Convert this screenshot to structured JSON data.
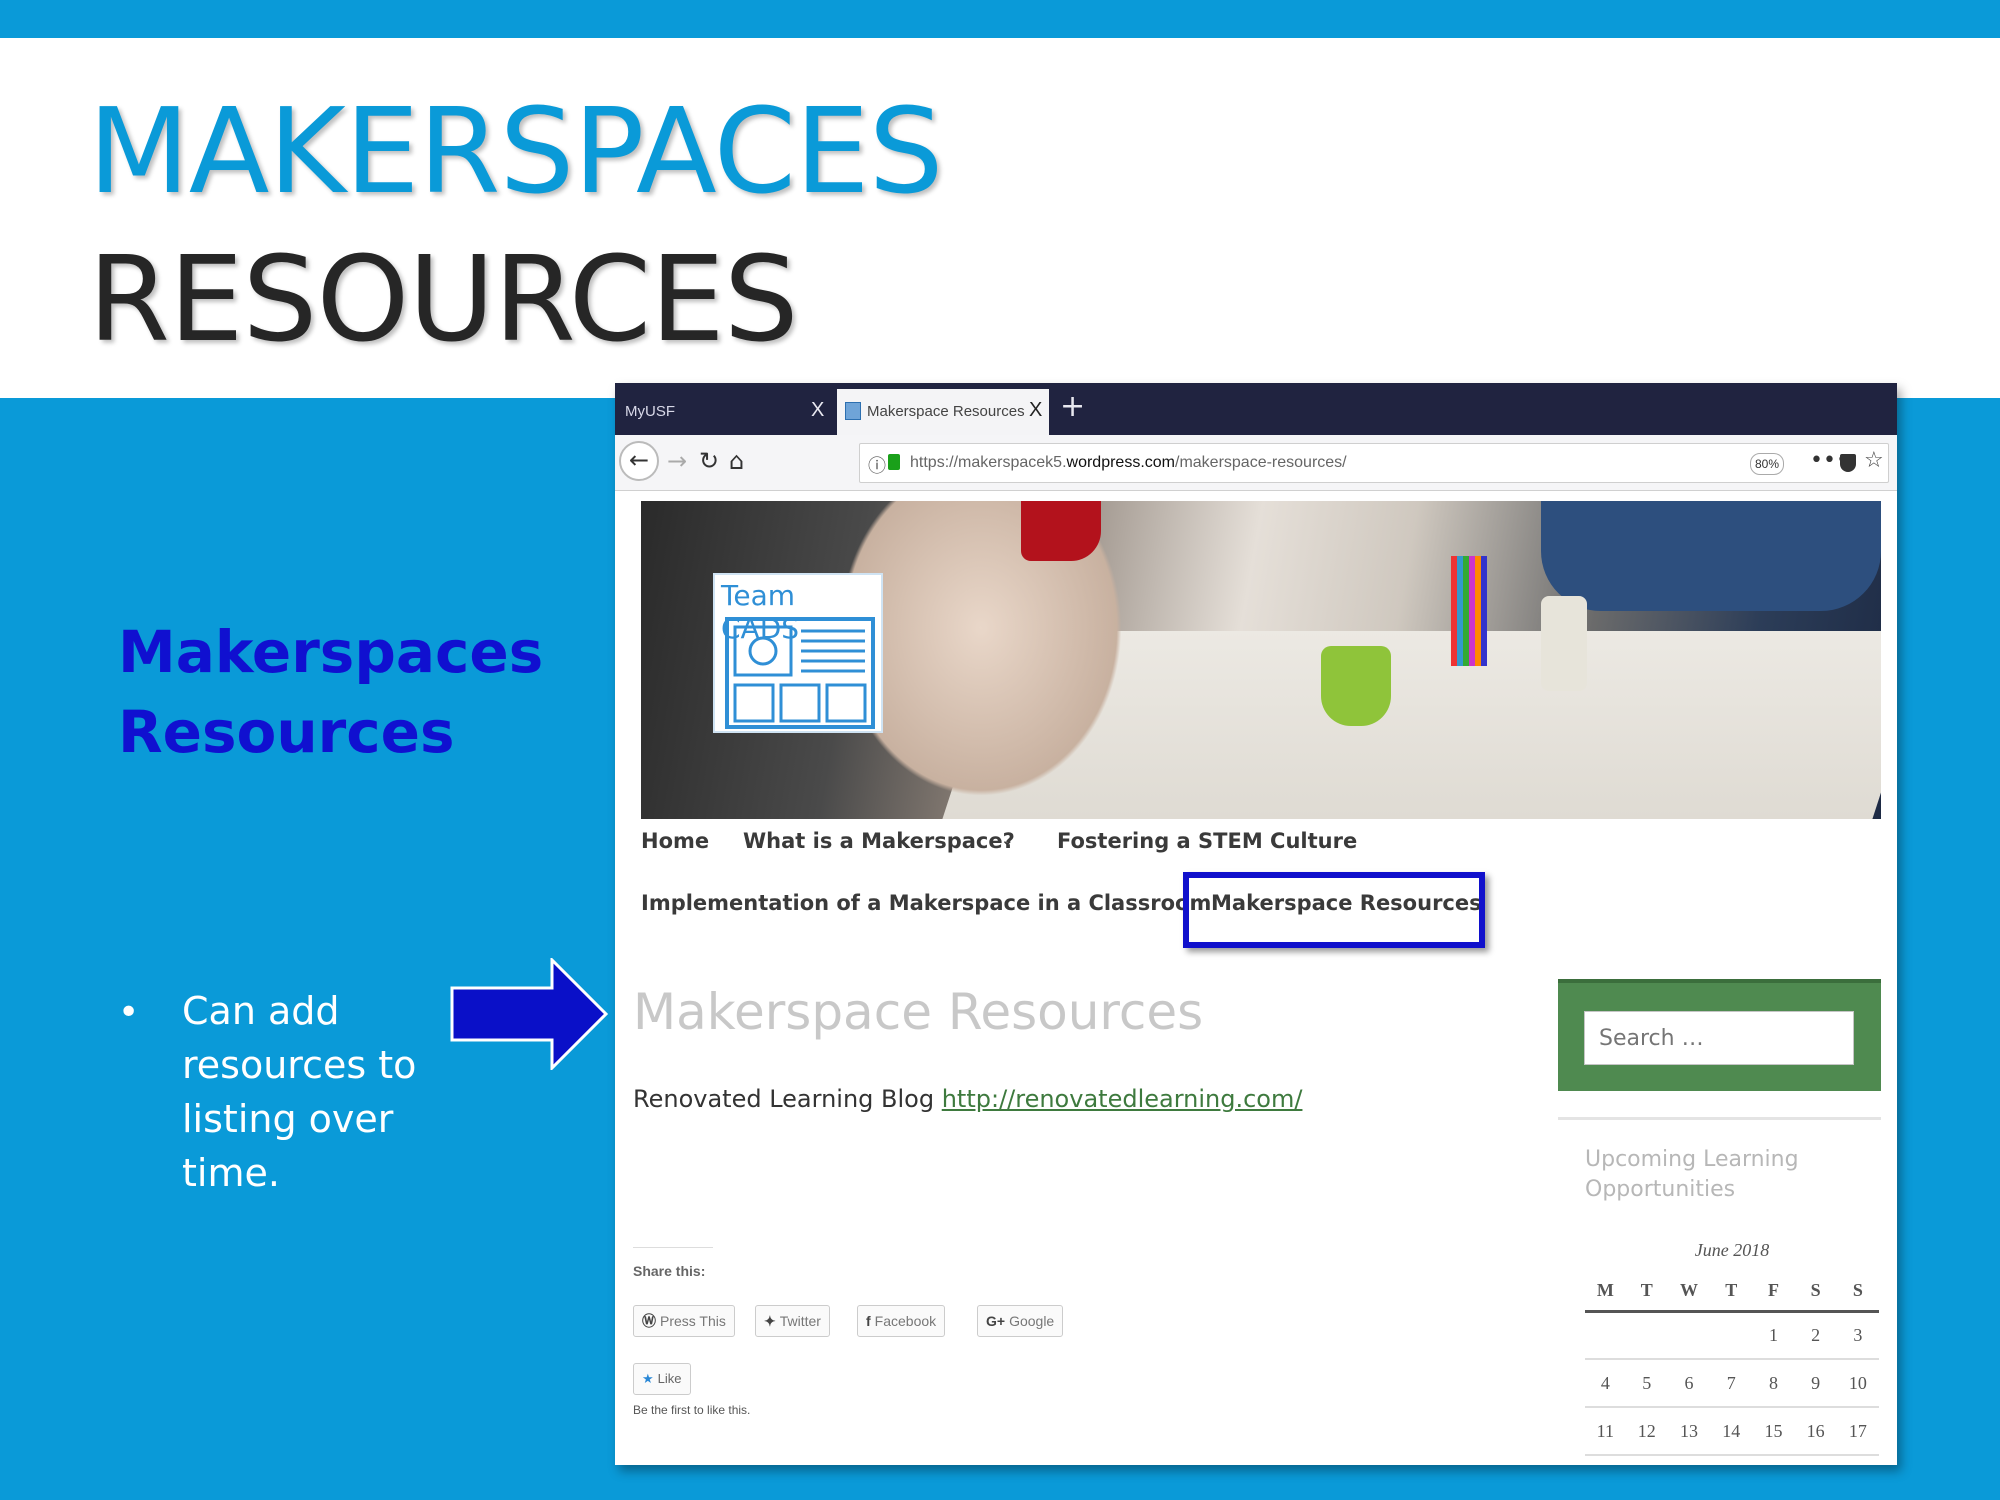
{
  "slide": {
    "title_line1": "MAKERSPACES",
    "title_line2": "RESOURCES",
    "subheading_line1": "Makerspaces",
    "subheading_line2": "Resources",
    "bullet": "Can add resources to listing over time.",
    "colors": {
      "band": "#0a9ad8",
      "title_blue": "#0a9ad8",
      "subheading": "#1010d0",
      "arrow": "#0a10c8",
      "highlight": "#1010cc"
    }
  },
  "browser": {
    "tabs": [
      {
        "label": "MyUSF",
        "close": "X",
        "active": false
      },
      {
        "label": "Makerspace Resources – Techn",
        "close": "X",
        "active": true
      }
    ],
    "new_tab": "+",
    "url_prefix": "https://makerspacek5.",
    "url_host": "wordpress.com",
    "url_path": "/makerspace-resources/",
    "zoom": "80%",
    "menu_dots": "•••"
  },
  "site": {
    "logo_text": "Team CADS",
    "menu": {
      "home": "Home",
      "what": "What is a Makerspace?",
      "stem": "Fostering a STEM Culture",
      "implementation": "Implementation of a Makerspace in a Classroom",
      "resources": "Makerspace Resources"
    },
    "page_title": "Makerspace Resources",
    "blog_label": "Renovated Learning Blog",
    "blog_url": "http://renovatedlearning.com/",
    "share_label": "Share this:",
    "share_buttons": [
      "Press This",
      "Twitter",
      "Facebook",
      "Google"
    ],
    "like_label": "Like",
    "like_note": "Be the first to like this.",
    "search_placeholder": "Search …",
    "widget_title": "Upcoming Learning Opportunities",
    "calendar": {
      "caption": "June 2018",
      "days": [
        "M",
        "T",
        "W",
        "T",
        "F",
        "S",
        "S"
      ],
      "weeks": [
        [
          "",
          "",
          "",
          "",
          "1",
          "2",
          "3"
        ],
        [
          "4",
          "5",
          "6",
          "7",
          "8",
          "9",
          "10"
        ],
        [
          "11",
          "12",
          "13",
          "14",
          "15",
          "16",
          "17"
        ]
      ]
    }
  }
}
